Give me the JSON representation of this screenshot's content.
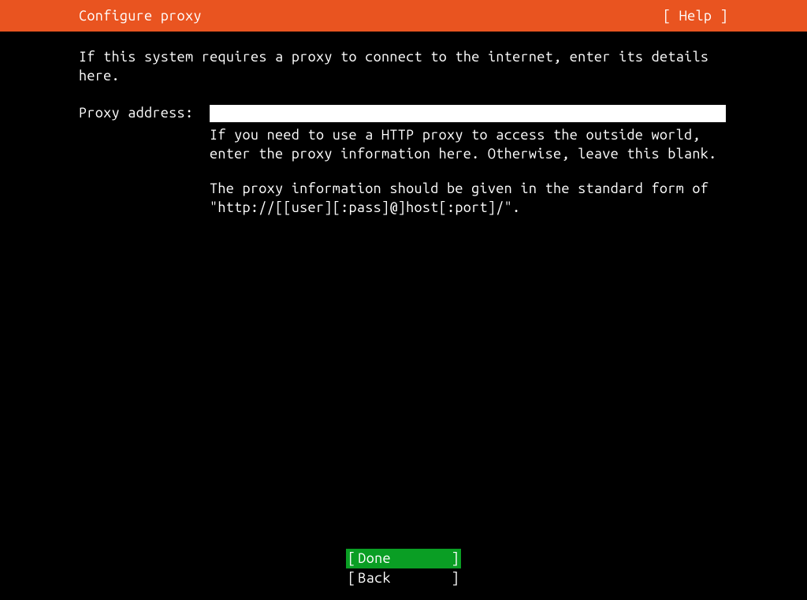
{
  "header": {
    "title": "Configure proxy",
    "help": "[ Help ]"
  },
  "content": {
    "instructions": "If this system requires a proxy to connect to the internet, enter its details here.",
    "form": {
      "label": "Proxy address:",
      "value": "",
      "help_line1": "If you need to use a HTTP proxy to access the outside world, enter the proxy information here. Otherwise, leave this blank.",
      "help_line2": "The proxy information should be given in the standard form of \"http://[[user][:pass]@]host[:port]/\"."
    }
  },
  "footer": {
    "done": "Done",
    "back": "Back"
  }
}
